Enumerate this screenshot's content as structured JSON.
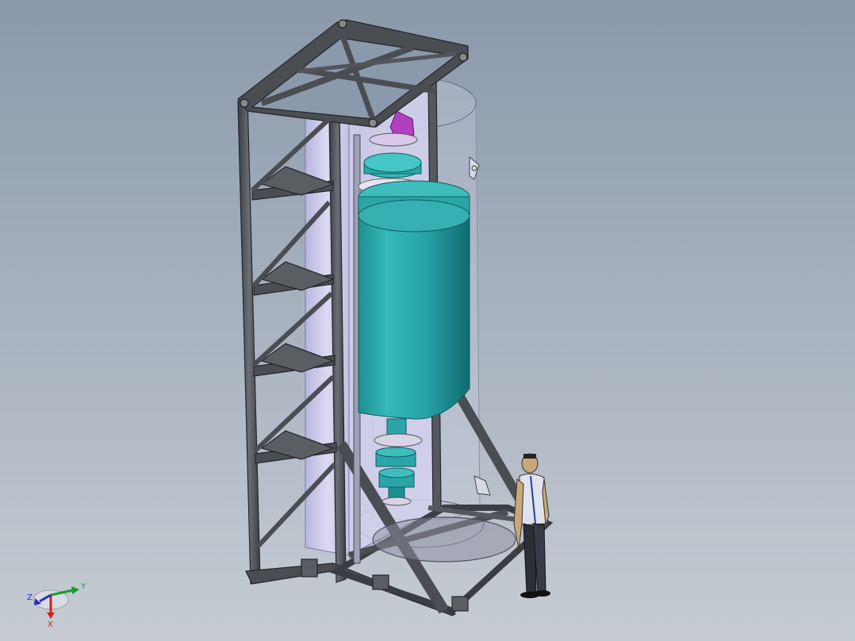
{
  "axes": {
    "x_label": "X",
    "y_label": "Y",
    "z_label": "Z",
    "x_color": "#d42020",
    "y_color": "#1a9a2a",
    "z_color": "#2030c0"
  },
  "colors": {
    "background_top": "#8a99ab",
    "background_bottom": "#c6ccd3",
    "frame_steel": "#4a4d52",
    "frame_edge": "#2a2c30",
    "vessel": "#2aa6a8",
    "vessel_dark": "#0f6e72",
    "enclosure": "#c9c6e6",
    "clamp": "#b040c0"
  },
  "icons": {
    "triad": "coordinate-triad-icon",
    "person": "human-figure-icon"
  }
}
